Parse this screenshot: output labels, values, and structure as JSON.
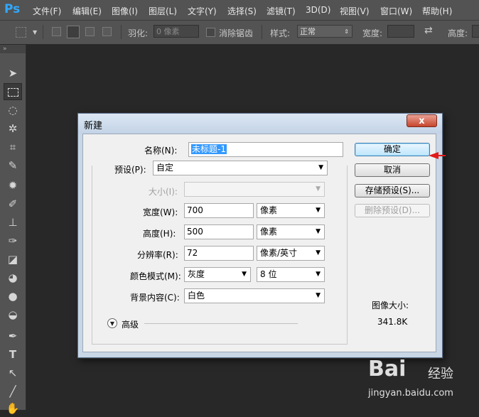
{
  "app": {
    "logo": "Ps"
  },
  "menubar": {
    "items": [
      "文件(F)",
      "编辑(E)",
      "图像(I)",
      "图层(L)",
      "文字(Y)",
      "选择(S)",
      "滤镜(T)",
      "3D(D)",
      "视图(V)",
      "窗口(W)",
      "帮助(H)"
    ]
  },
  "options": {
    "feather_label": "羽化:",
    "feather_value": "0 像素",
    "antialias_label": "消除锯齿",
    "style_label": "样式:",
    "style_value": "正常",
    "width_label": "宽度:",
    "height_label": "高度:"
  },
  "dialog": {
    "title": "新建",
    "close_glyph": "x",
    "name_label": "名称(N):",
    "name_value": "未标题-1",
    "preset_label": "预设(P):",
    "preset_value": "自定",
    "size_label": "大小(I):",
    "width_label": "宽度(W):",
    "width_value": "700",
    "width_unit": "像素",
    "height_label": "高度(H):",
    "height_value": "500",
    "height_unit": "像素",
    "resolution_label": "分辨率(R):",
    "resolution_value": "72",
    "resolution_unit": "像素/英寸",
    "color_mode_label": "颜色模式(M):",
    "color_mode_value": "灰度",
    "bit_depth_value": "8 位",
    "background_label": "背景内容(C):",
    "background_value": "白色",
    "advanced_label": "高级",
    "ok_label": "确定",
    "cancel_label": "取消",
    "save_preset_label": "存储预设(S)...",
    "delete_preset_label": "删除预设(D)...",
    "image_size_label": "图像大小:",
    "image_size_value": "341.8K"
  },
  "watermark": {
    "logo_left": "Bai",
    "logo_right": "经验",
    "url": "jingyan.baidu.com"
  },
  "colors": {
    "ps_blue": "#31a8ff",
    "annotation_arrow": "#e01b1b"
  }
}
